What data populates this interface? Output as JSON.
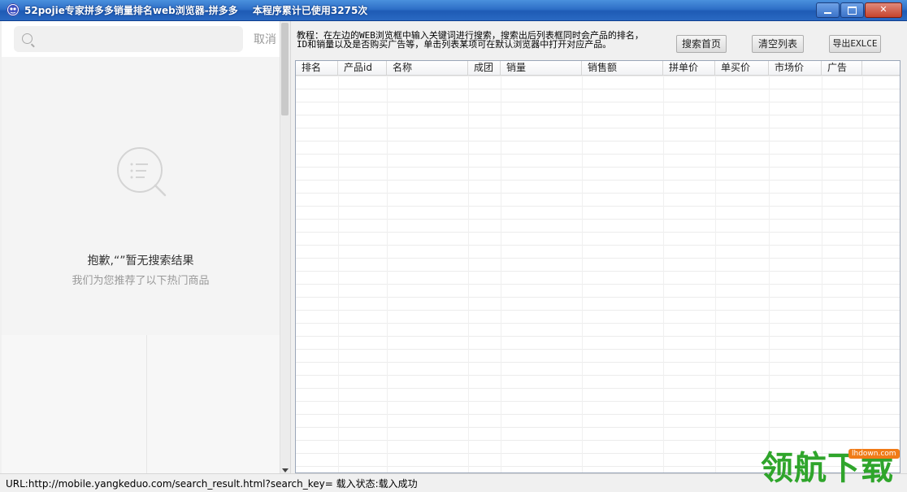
{
  "window": {
    "title": "52pojie专家拼多多销量排名web浏览器-拼多多",
    "usage": "本程序累计已使用3275次"
  },
  "browser": {
    "search_placeholder": "",
    "cancel_label": "取消",
    "empty_message": "抱歉,“”暂无搜索结果",
    "empty_sub": "我们为您推荐了以下热门商品"
  },
  "tutorial": {
    "line1": "教程：在左边的WEB浏览框中输入关键词进行搜索，搜索出后列表框同时会产品的排名，",
    "line2": "ID和销量以及是否购买广告等，单击列表某项可在默认浏览器中打开对应产品。"
  },
  "toolbar": {
    "search_home": "搜索首页",
    "clear_list": "清空列表",
    "export": "导出EXLCE"
  },
  "grid": {
    "columns": [
      "排名",
      "产品id",
      "名称",
      "成团",
      "销量",
      "销售额",
      "拼单价",
      "单买价",
      "市场价",
      "广告"
    ]
  },
  "status": {
    "text": "URL:http://mobile.yangkeduo.com/search_result.html?search_key=  载入状态:载入成功"
  },
  "watermark": {
    "text": "领航下载",
    "badge": "lhdown.com"
  }
}
